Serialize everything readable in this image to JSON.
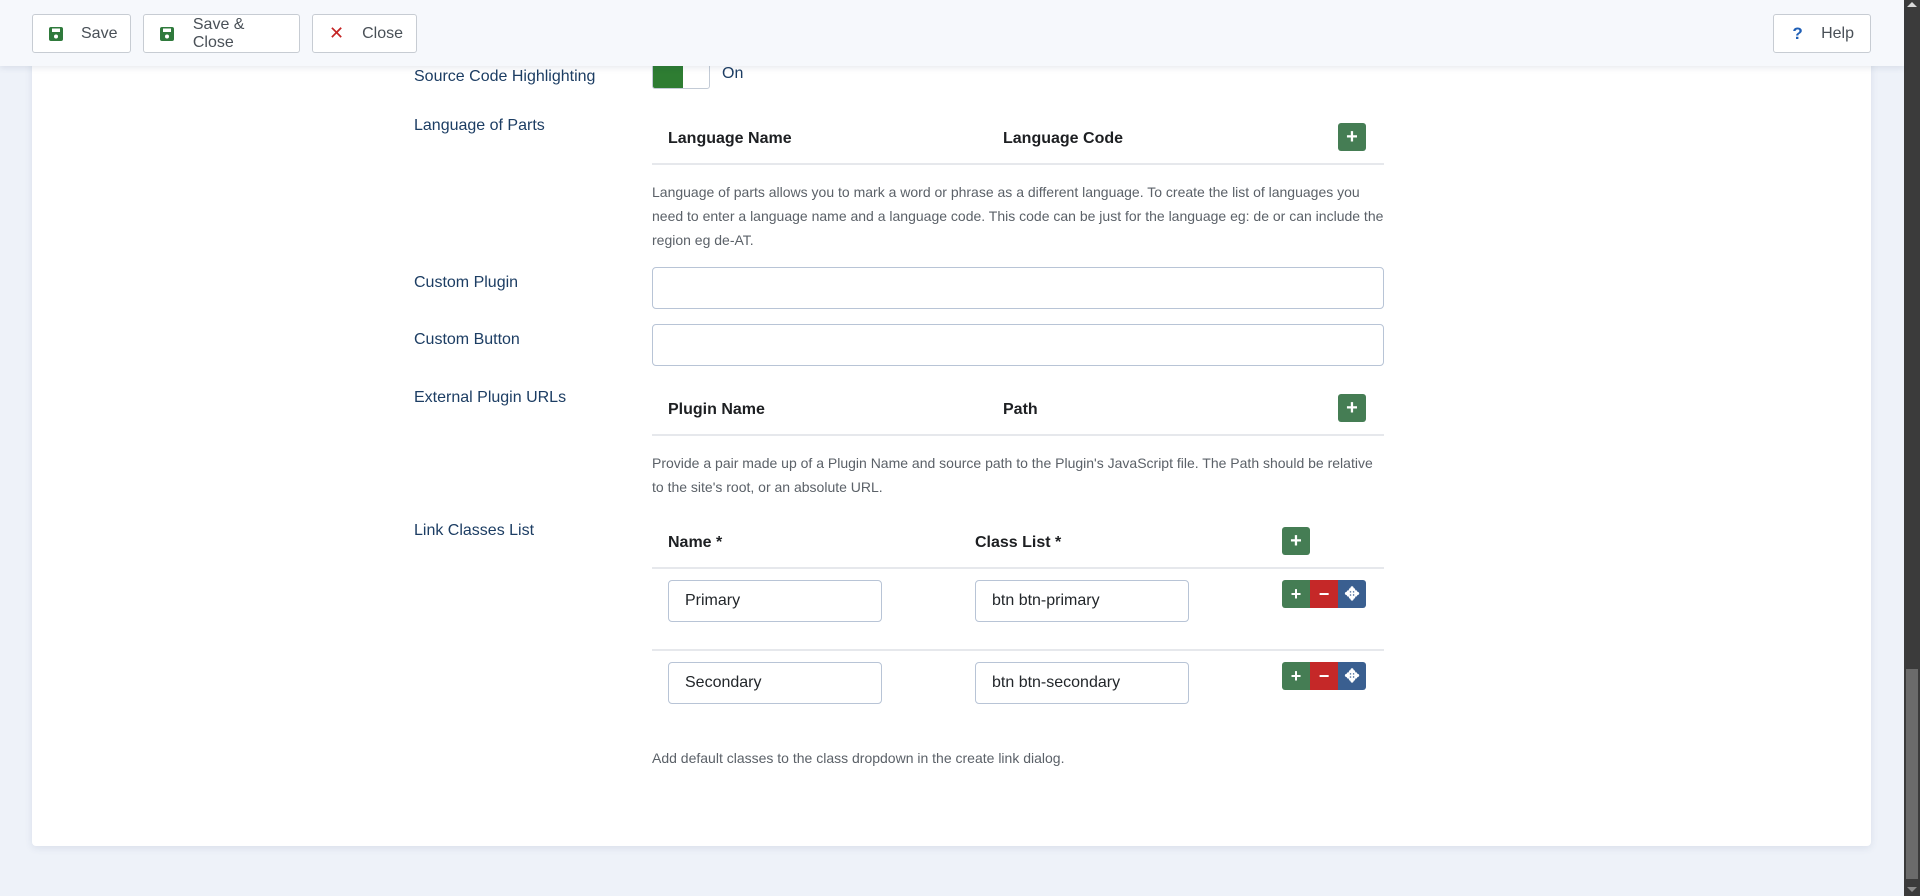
{
  "toolbar": {
    "save_label": "Save",
    "save_close_label": "Save & Close",
    "close_label": "Close",
    "help_label": "Help",
    "help_glyph": "?",
    "close_glyph": "✕"
  },
  "fields": {
    "source_code_highlighting": {
      "label": "Source Code Highlighting",
      "state": "On",
      "enabled": true
    },
    "language_of_parts": {
      "label": "Language of Parts",
      "columns": [
        "Language Name",
        "Language Code"
      ],
      "description": "Language of parts allows you to mark a word or phrase as a different language. To create the list of languages you need to enter a language name and a language code. This code can be just for the language eg: de or can include the region eg de-AT."
    },
    "custom_plugin": {
      "label": "Custom Plugin",
      "value": ""
    },
    "custom_button": {
      "label": "Custom Button",
      "value": ""
    },
    "external_plugin_urls": {
      "label": "External Plugin URLs",
      "columns": [
        "Plugin Name",
        "Path"
      ],
      "description": "Provide a pair made up of a Plugin Name and source path to the Plugin's JavaScript file. The Path should be relative to the site's root, or an absolute URL."
    },
    "link_classes_list": {
      "label": "Link Classes List",
      "columns": [
        "Name *",
        "Class List *"
      ],
      "rows": [
        {
          "name": "Primary",
          "class_list": "btn btn-primary"
        },
        {
          "name": "Secondary",
          "class_list": "btn btn-secondary"
        }
      ],
      "description": "Add default classes to the class dropdown in the create link dialog."
    }
  },
  "glyphs": {
    "add": "+",
    "remove": "−",
    "move": "✥"
  },
  "colors": {
    "success": "#457d54",
    "danger": "#c52828",
    "primary": "#3a5f90",
    "toggle_on": "#2e7d32",
    "label": "#1c3d63"
  }
}
